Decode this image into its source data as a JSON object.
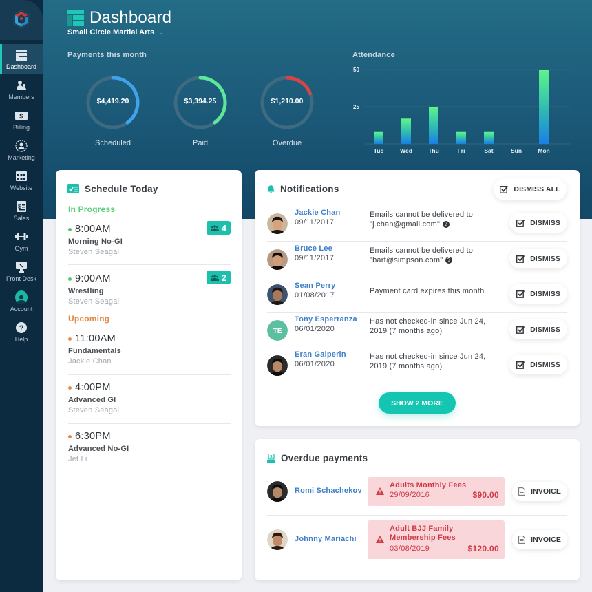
{
  "app": {
    "title": "Dashboard",
    "organization": "Small Circle Martial Arts"
  },
  "sidebar": {
    "items": [
      {
        "label": "Dashboard",
        "icon": "dashboard-icon",
        "active": true
      },
      {
        "label": "Members",
        "icon": "members-icon"
      },
      {
        "label": "Billing",
        "icon": "billing-icon"
      },
      {
        "label": "Marketing",
        "icon": "marketing-icon"
      },
      {
        "label": "Website",
        "icon": "website-icon"
      },
      {
        "label": "Sales",
        "icon": "sales-icon"
      },
      {
        "label": "Gym",
        "icon": "dumbbell-icon"
      },
      {
        "label": "Front Desk",
        "icon": "front-desk-icon"
      },
      {
        "label": "Account",
        "icon": "account-icon"
      },
      {
        "label": "Help",
        "icon": "help-icon"
      }
    ]
  },
  "payments": {
    "label": "Payments this month",
    "items": [
      {
        "value": "$4,419.20",
        "label": "Scheduled",
        "progress": 0.4,
        "color": "#3fa2ea"
      },
      {
        "value": "$3,394.25",
        "label": "Paid",
        "progress": 0.4,
        "color": "#5ce79a"
      },
      {
        "value": "$1,210.00",
        "label": "Overdue",
        "progress": 0.19,
        "color": "#d64545"
      }
    ]
  },
  "chart_data": {
    "type": "bar",
    "title": "Attendance",
    "categories": [
      "Tue",
      "Wed",
      "Thu",
      "Fri",
      "Sat",
      "Sun",
      "Mon"
    ],
    "values": [
      8,
      17,
      25,
      8,
      8,
      0,
      50
    ],
    "yticks": [
      25,
      50
    ],
    "ylim": [
      0,
      50
    ],
    "xlabel": "",
    "ylabel": "",
    "grid": true
  },
  "schedule": {
    "title": "Schedule Today",
    "in_progress_label": "In Progress",
    "upcoming_label": "Upcoming",
    "in_progress": [
      {
        "time": "8:00AM",
        "class": "Morning No-GI",
        "instructor": "Steven Seagal",
        "count": "4"
      },
      {
        "time": "9:00AM",
        "class": "Wrestling",
        "instructor": "Steven Seagal",
        "count": "2"
      }
    ],
    "upcoming": [
      {
        "time": "11:00AM",
        "class": "Fundamentals",
        "instructor": "Jackie Chan"
      },
      {
        "time": "4:00PM",
        "class": "Advanced GI",
        "instructor": "Steven Seagal"
      },
      {
        "time": "6:30PM",
        "class": "Advanced No-GI",
        "instructor": "Jet Li"
      }
    ]
  },
  "notifications": {
    "title": "Notifications",
    "dismiss_all_label": "DISMISS ALL",
    "dismiss_label": "DISMISS",
    "show_more_label": "SHOW 2 MORE",
    "items": [
      {
        "name": "Jackie Chan",
        "date": "09/11/2017",
        "line1": "Emails cannot be delivered to",
        "line2": "\"j.chan@gmail.com\"",
        "help": true
      },
      {
        "name": "Bruce Lee",
        "date": "09/11/2017",
        "line1": "Emails cannot be delivered to",
        "line2": "\"bart@simpson.com\"",
        "help": true
      },
      {
        "name": "Sean Perry",
        "date": "01/08/2017",
        "line1": "Payment card expires this month",
        "line2": ""
      },
      {
        "name": "Tony Esperranza",
        "date": "06/01/2020",
        "initials": "TE",
        "line1": "Has not checked-in since Jun 24,",
        "line2": "2019 (7 months ago)"
      },
      {
        "name": "Eran Galperin",
        "date": "06/01/2020",
        "line1": "Has not checked-in since Jun 24,",
        "line2": "2019 (7 months ago)"
      }
    ]
  },
  "overdue": {
    "title": "Overdue payments",
    "invoice_label": "INVOICE",
    "items": [
      {
        "name": "Romi Schachekov",
        "description": "Adults Monthly Fees",
        "date": "29/09/2016",
        "amount": "$90.00"
      },
      {
        "name": "Johnny Mariachi",
        "description": "Adult BJJ Family Membership Fees",
        "date": "03/08/2019",
        "amount": "$120.00"
      }
    ]
  }
}
